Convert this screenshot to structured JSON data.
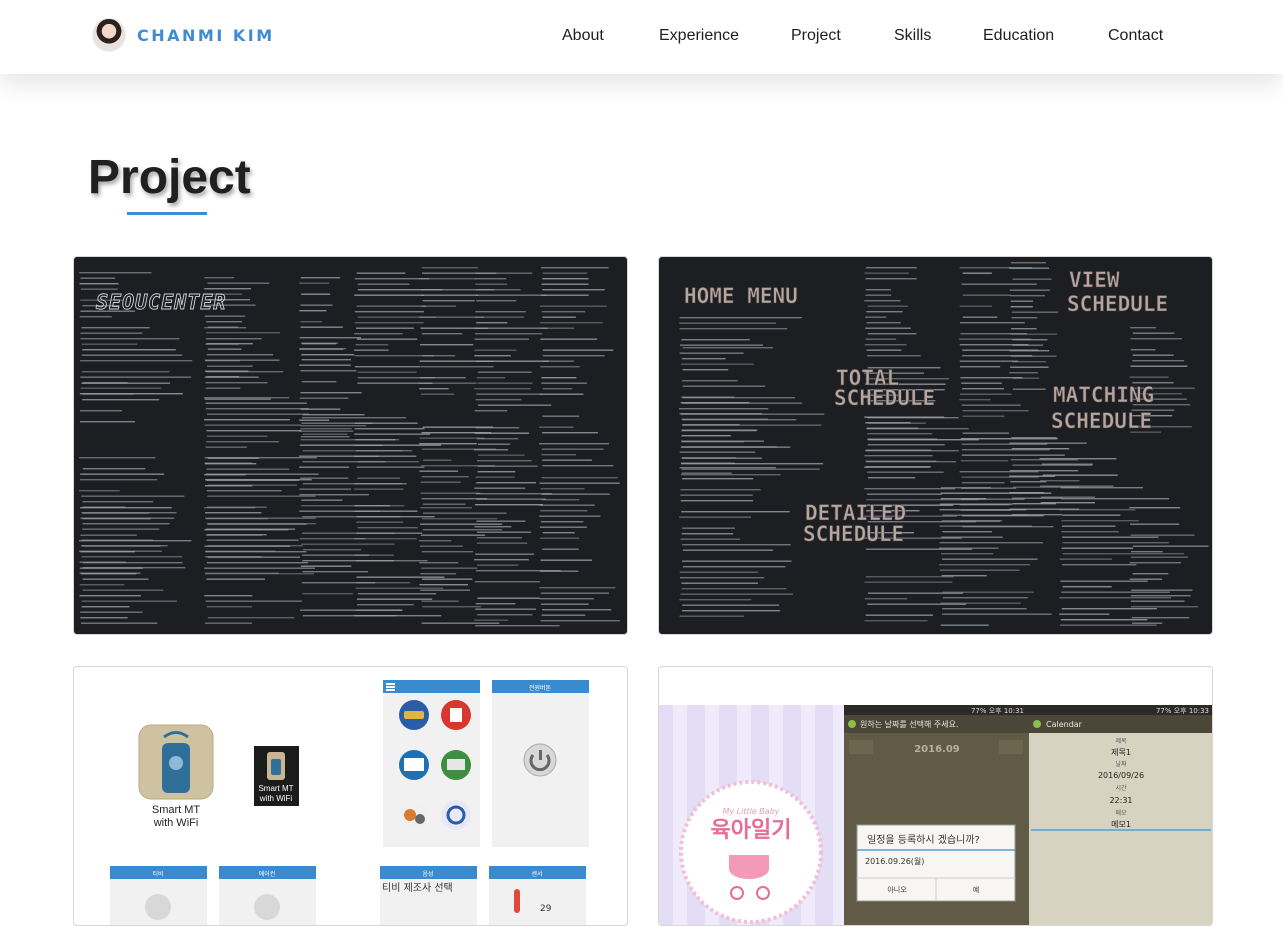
{
  "brand": {
    "name": "CHANMI KIM"
  },
  "nav": {
    "items": [
      {
        "label": "About"
      },
      {
        "label": "Experience"
      },
      {
        "label": "Project"
      },
      {
        "label": "Skills"
      },
      {
        "label": "Education"
      },
      {
        "label": "Contact"
      }
    ]
  },
  "section": {
    "title": "Project"
  },
  "projects": [
    {
      "logo_text": "SEOUCENTER"
    },
    {
      "labels": {
        "home": "HOME MENU",
        "view1": "VIEW",
        "view2": "SCHEDULE",
        "total1": "TOTAL",
        "total2": "SCHEDULE",
        "match1": "MATCHING",
        "match2": "SCHEDULE",
        "detail1": "DETAILED",
        "detail2": "SCHEDULE"
      }
    },
    {
      "app_name1": "Smart MT",
      "app_name2": "with WiFi",
      "small_name1": "Smart MT",
      "small_name2": "with WiFi",
      "screen_header": "전원버튼",
      "bottom_header1": "티비",
      "bottom_header2": "에어컨",
      "bottom_header3": "음성",
      "bottom_header4": "센서",
      "tv_select": "티비 제조사 선택",
      "temp": "29"
    },
    {
      "diary_tag": "My Little Baby",
      "diary_title": "육아일기",
      "status_left": "77% 오후 10:31",
      "status_right": "77% 오후 10:33",
      "picker_title": "원하는 날짜를 선택해 주세요.",
      "picker_date": "2016.09",
      "dialog_question": "일정을 등록하시 겠습니까?",
      "dialog_date": "2016.09.26(월)",
      "dialog_no": "아니오",
      "dialog_yes": "예",
      "calendar_title": "Calendar",
      "fields": [
        {
          "label": "제목",
          "value": "제목1"
        },
        {
          "label": "날짜",
          "value": "2016/09/26"
        },
        {
          "label": "시간",
          "value": "22:31"
        },
        {
          "label": "메모",
          "value": "메모1"
        }
      ]
    }
  ]
}
